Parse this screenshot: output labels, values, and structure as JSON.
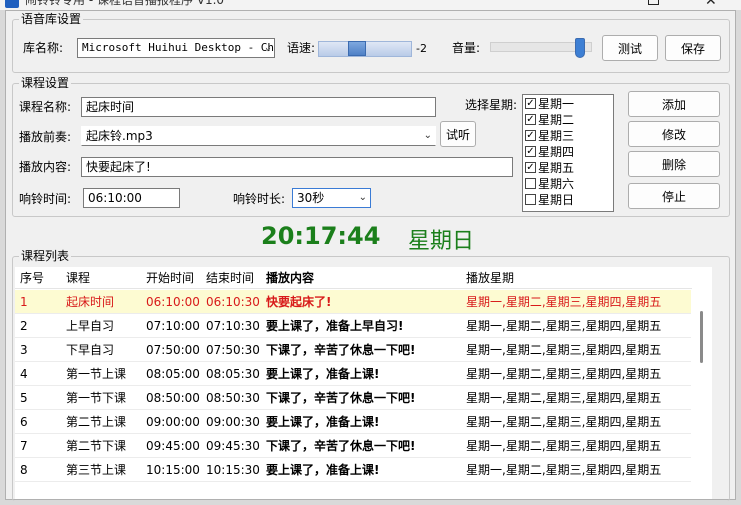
{
  "window": {
    "title": "闹铃铃专用 - 课程语音播报程序 V1.0"
  },
  "voice_group": {
    "legend": "语音库设置",
    "library_label": "库名称:",
    "library_value": "Microsoft Huihui Desktop - Chi",
    "speed_label": "语速:",
    "speed_value": "-2",
    "volume_label": "音量:",
    "test_button": "测试",
    "save_button": "保存"
  },
  "course_group": {
    "legend": "课程设置",
    "name_label": "课程名称:",
    "name_value": "起床时间",
    "pre_play_label": "播放前奏:",
    "pre_play_value": "起床铃.mp3",
    "listen_button": "试听",
    "content_label": "播放内容:",
    "content_value": "快要起床了!",
    "ring_time_label": "响铃时间:",
    "ring_time_value": "06:10:00",
    "ring_duration_label": "响铃时长:",
    "ring_duration_value": "30秒",
    "select_week_label": "选择星期:",
    "weekdays": [
      {
        "label": "星期一",
        "checked": "✓"
      },
      {
        "label": "星期二",
        "checked": "✓"
      },
      {
        "label": "星期三",
        "checked": "✓"
      },
      {
        "label": "星期四",
        "checked": "✓"
      },
      {
        "label": "星期五",
        "checked": "✓"
      },
      {
        "label": "星期六",
        "checked": ""
      },
      {
        "label": "星期日",
        "checked": ""
      }
    ],
    "add_button": "添加",
    "edit_button": "修改",
    "delete_button": "删除",
    "stop_button": "停止"
  },
  "clock": {
    "time": "20:17:44",
    "weekday": "星期日"
  },
  "list_group": {
    "legend": "课程列表",
    "headers": [
      "序号",
      "课程",
      "开始时间",
      "结束时间",
      "播放内容",
      "播放星期"
    ],
    "rows": [
      {
        "no": "1",
        "course": "起床时间",
        "start": "06:10:00",
        "end": "06:10:30",
        "content": "快要起床了!",
        "days": "星期一,星期二,星期三,星期四,星期五"
      },
      {
        "no": "2",
        "course": "上早自习",
        "start": "07:10:00",
        "end": "07:10:30",
        "content": "要上课了，准备上早自习!",
        "days": "星期一,星期二,星期三,星期四,星期五"
      },
      {
        "no": "3",
        "course": "下早自习",
        "start": "07:50:00",
        "end": "07:50:30",
        "content": "下课了，辛苦了休息一下吧!",
        "days": "星期一,星期二,星期三,星期四,星期五"
      },
      {
        "no": "4",
        "course": "第一节上课",
        "start": "08:05:00",
        "end": "08:05:30",
        "content": "要上课了，准备上课!",
        "days": "星期一,星期二,星期三,星期四,星期五"
      },
      {
        "no": "5",
        "course": "第一节下课",
        "start": "08:50:00",
        "end": "08:50:30",
        "content": "下课了，辛苦了休息一下吧!",
        "days": "星期一,星期二,星期三,星期四,星期五"
      },
      {
        "no": "6",
        "course": "第二节上课",
        "start": "09:00:00",
        "end": "09:00:30",
        "content": "要上课了，准备上课!",
        "days": "星期一,星期二,星期三,星期四,星期五"
      },
      {
        "no": "7",
        "course": "第二节下课",
        "start": "09:45:00",
        "end": "09:45:30",
        "content": "下课了，辛苦了休息一下吧!",
        "days": "星期一,星期二,星期三,星期四,星期五"
      },
      {
        "no": "8",
        "course": "第三节上课",
        "start": "10:15:00",
        "end": "10:15:30",
        "content": "要上课了，准备上课!",
        "days": "星期一,星期二,星期三,星期四,星期五"
      }
    ]
  },
  "colors": {
    "clock_green": "#1b7f1b",
    "selected_row_bg": "#fdfbd2",
    "selected_row_text": "#d81a1a"
  }
}
